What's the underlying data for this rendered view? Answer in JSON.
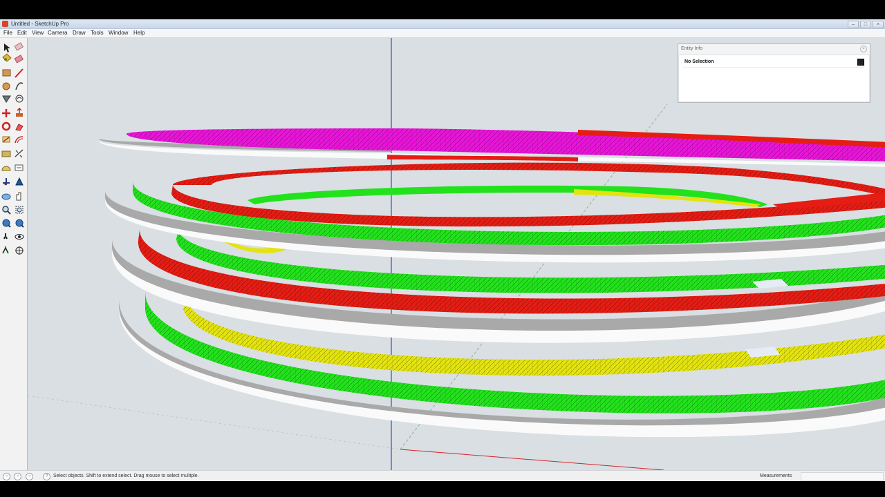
{
  "window": {
    "title": "Untitled - SketchUp Pro",
    "controls": [
      "minimize",
      "maximize",
      "close"
    ]
  },
  "menu": [
    "File",
    "Edit",
    "View",
    "Camera",
    "Draw",
    "Tools",
    "Window",
    "Help"
  ],
  "toolbar": {
    "tools": [
      "select-tool",
      "eraser-tool",
      "paint-bucket-tool",
      "eraser-tool",
      "rectangle-tool",
      "line-tool",
      "circle-tool",
      "arc-tool",
      "polygon-tool",
      "freehand-tool",
      "move-tool",
      "push-pull-tool",
      "rotate-tool",
      "follow-me-tool",
      "scale-tool",
      "offset-tool",
      "tape-measure-tool",
      "dimension-tool",
      "protractor-tool",
      "text-tool",
      "axes-tool",
      "3d-text-tool",
      "orbit-tool",
      "pan-tool",
      "zoom-tool",
      "zoom-window-tool",
      "zoom-extents-tool",
      "previous-view-tool",
      "walk-tool",
      "look-around-tool",
      "position-camera-tool",
      "section-plane-tool"
    ]
  },
  "entity_info": {
    "title": "Entity Info",
    "value": "No Selection"
  },
  "status": {
    "hint": "Select objects. Shift to extend select. Drag mouse to select multiple.",
    "measurements_label": "Measurements",
    "measurements_value": ""
  },
  "colors": {
    "ring_gray": "#a9a9a9",
    "ring_white": "#fafafa",
    "band_green": "#22e21c",
    "band_red": "#e51d14",
    "band_yellow": "#e3e30f",
    "band_magenta": "#e815d8",
    "axis_blue": "#2a4fd6",
    "axis_red": "#d3242c",
    "axis_green": "#4f9a4f",
    "viewport_bg": "#d9dfe2"
  }
}
